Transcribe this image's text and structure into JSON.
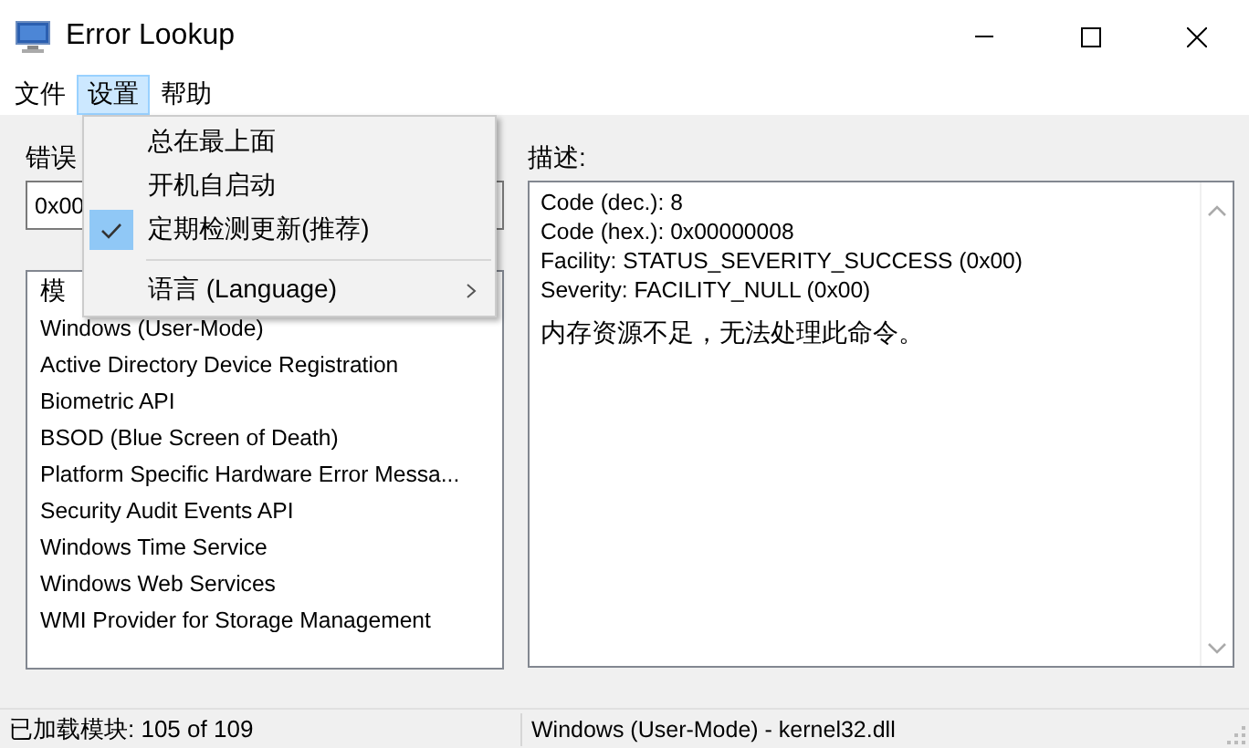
{
  "window": {
    "title": "Error Lookup"
  },
  "menu_bar": [
    {
      "label": "文件",
      "selected": false
    },
    {
      "label": "设置",
      "selected": true
    },
    {
      "label": "帮助",
      "selected": false
    }
  ],
  "dropdown": [
    {
      "kind": "item",
      "label": "总在最上面",
      "checked": false
    },
    {
      "kind": "item",
      "label": "开机自启动",
      "checked": false
    },
    {
      "kind": "item",
      "label": "定期检测更新(推荐)",
      "checked": true
    },
    {
      "kind": "separator"
    },
    {
      "kind": "submenu",
      "label": "语言 (Language)"
    }
  ],
  "error_label": "错误",
  "error_field": {
    "value": "0x00"
  },
  "modules": {
    "header": "模",
    "items": [
      "Windows (User-Mode)",
      "Active Directory Device Registration",
      "Biometric API",
      "BSOD (Blue Screen of Death)",
      "Platform Specific Hardware Error Messa...",
      "Security Audit Events API",
      "Windows Time Service",
      "Windows Web Services",
      "WMI Provider for Storage Management"
    ]
  },
  "description": {
    "label": "描述:",
    "lines": [
      "Code (dec.): 8",
      "Code (hex.): 0x00000008",
      "Facility: STATUS_SEVERITY_SUCCESS (0x00)",
      "Severity: FACILITY_NULL (0x00)"
    ],
    "message": "内存资源不足，无法处理此命令。"
  },
  "status_bar": [
    "已加载模块: 105 of 109",
    "Windows (User-Mode) - kernel32.dll"
  ]
}
